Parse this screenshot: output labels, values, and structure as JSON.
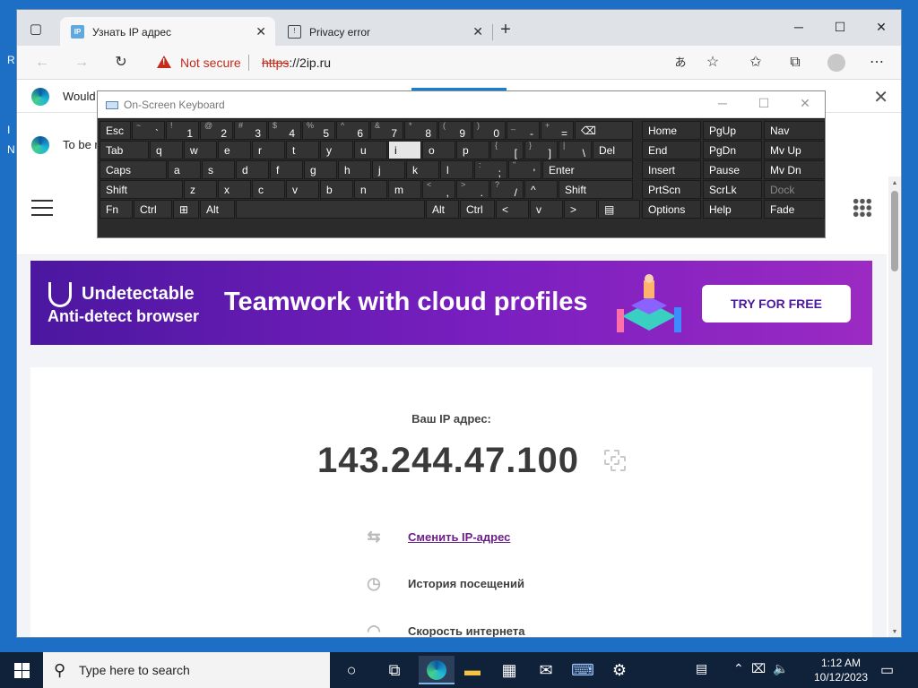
{
  "desktop": {
    "letters": [
      "R",
      "I",
      "N"
    ]
  },
  "browser": {
    "tabs": [
      {
        "label": "Узнать IP адрес",
        "favicon": "IP",
        "active": true
      },
      {
        "label": "Privacy error",
        "active": false
      }
    ],
    "window_controls": {
      "minimize": "─",
      "maximize": "☐",
      "close": "✕"
    },
    "address": {
      "warning": "Not secure",
      "scheme": "https",
      "rest": "://2ip.ru"
    },
    "notifications": [
      {
        "text": "Would"
      },
      {
        "text": "To be r"
      }
    ]
  },
  "osk": {
    "title": "On-Screen Keyboard",
    "rows": [
      [
        {
          "m": "Esc",
          "w": 36
        },
        {
          "t": "~",
          "b": "`"
        },
        {
          "t": "!",
          "b": "1"
        },
        {
          "t": "@",
          "b": "2"
        },
        {
          "t": "#",
          "b": "3"
        },
        {
          "t": "$",
          "b": "4"
        },
        {
          "t": "%",
          "b": "5"
        },
        {
          "t": "^",
          "b": "6"
        },
        {
          "t": "&",
          "b": "7"
        },
        {
          "t": "*",
          "b": "8"
        },
        {
          "t": "(",
          "b": "9"
        },
        {
          "t": ")",
          "b": "0"
        },
        {
          "t": "_",
          "b": "-"
        },
        {
          "t": "+",
          "b": "="
        },
        {
          "m": "⌫",
          "w": 66
        }
      ],
      [
        {
          "m": "Tab",
          "w": 56
        },
        {
          "m": "q"
        },
        {
          "m": "w"
        },
        {
          "m": "e"
        },
        {
          "m": "r"
        },
        {
          "m": "t"
        },
        {
          "m": "y"
        },
        {
          "m": "u"
        },
        {
          "m": "i",
          "hl": true
        },
        {
          "m": "o"
        },
        {
          "m": "p"
        },
        {
          "t": "{",
          "b": "["
        },
        {
          "t": "}",
          "b": "]"
        },
        {
          "t": "|",
          "b": "\\"
        },
        {
          "m": "Del",
          "w": 46
        }
      ],
      [
        {
          "m": "Caps",
          "w": 76
        },
        {
          "m": "a"
        },
        {
          "m": "s"
        },
        {
          "m": "d"
        },
        {
          "m": "f"
        },
        {
          "m": "g"
        },
        {
          "m": "h"
        },
        {
          "m": "j"
        },
        {
          "m": "k"
        },
        {
          "m": "l"
        },
        {
          "t": ":",
          "b": ";"
        },
        {
          "t": "\"",
          "b": "'"
        },
        {
          "m": "Enter",
          "w": 102
        }
      ],
      [
        {
          "m": "Shift",
          "w": 94
        },
        {
          "m": "z"
        },
        {
          "m": "x"
        },
        {
          "m": "c"
        },
        {
          "m": "v"
        },
        {
          "m": "b"
        },
        {
          "m": "n"
        },
        {
          "m": "m"
        },
        {
          "t": "<",
          "b": ","
        },
        {
          "t": ">",
          "b": "."
        },
        {
          "t": "?",
          "b": "/"
        },
        {
          "m": "^"
        },
        {
          "m": "Shift",
          "w": 84
        }
      ],
      [
        {
          "m": "Fn",
          "w": 38
        },
        {
          "m": "Ctrl",
          "w": 44
        },
        {
          "m": "⊞",
          "w": 30
        },
        {
          "m": "Alt",
          "w": 40
        },
        {
          "m": "",
          "w": 212
        },
        {
          "m": "Alt",
          "w": 38
        },
        {
          "m": "Ctrl",
          "w": 40
        },
        {
          "m": "<"
        },
        {
          "m": "v"
        },
        {
          "m": ">"
        },
        {
          "m": "▤",
          "w": 48
        }
      ]
    ],
    "nav_cols": [
      [
        "Home",
        "End",
        "Insert",
        "PrtScn",
        "Options"
      ],
      [
        "PgUp",
        "PgDn",
        "Pause",
        "ScrLk",
        "Help"
      ],
      [
        "Nav",
        "Mv Up",
        "Mv Dn",
        "Dock",
        "Fade"
      ]
    ]
  },
  "ad": {
    "brand": "Undetectable",
    "subtitle": "Anti-detect browser",
    "headline": "Teamwork with cloud profiles",
    "cta": "TRY FOR FREE"
  },
  "card": {
    "ip_label": "Ваш IP адрес:",
    "ip_value": "143.244.47.100",
    "links": [
      {
        "label": "Сменить IP-адрес",
        "icon": "switch-icon",
        "link": true
      },
      {
        "label": "История посещений",
        "icon": "history-icon",
        "link": false
      },
      {
        "label": "Скорость интернета",
        "icon": "speed-icon",
        "link": false
      }
    ]
  },
  "taskbar": {
    "search_placeholder": "Type here to search",
    "time": "1:12 AM",
    "date": "10/12/2023"
  },
  "colors": {
    "accent": "#1a7fd4",
    "warning": "#c42b1c",
    "ad_start": "#4b17a0",
    "ad_end": "#9b2ac2",
    "link": "#6a1f87"
  }
}
